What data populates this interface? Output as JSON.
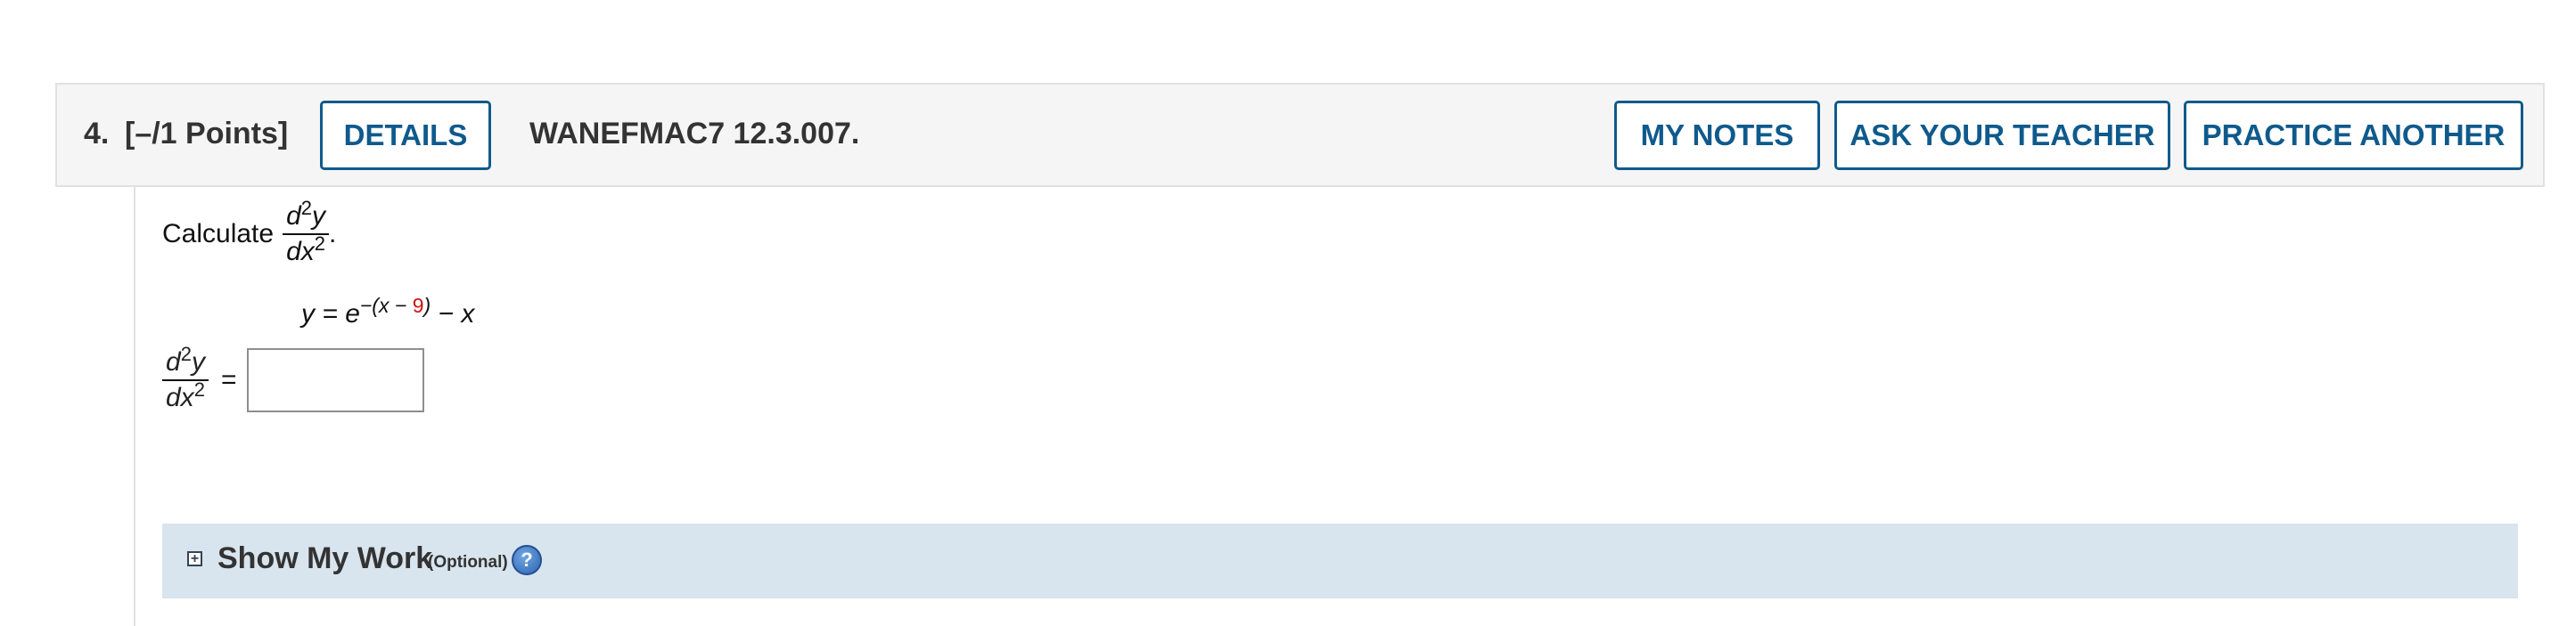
{
  "question": {
    "number": "4.",
    "points": "[–/1 Points]",
    "code": "WANEFMAC7 12.3.007."
  },
  "buttons": {
    "details": "DETAILS",
    "my_notes": "MY NOTES",
    "ask_teacher": "ASK YOUR TEACHER",
    "practice_another": "PRACTICE ANOTHER"
  },
  "prompt": {
    "calculate_label": "Calculate",
    "derivative_numerator": "d",
    "derivative_numerator_exp": "2",
    "derivative_numerator_var": "y",
    "derivative_denominator": "dx",
    "derivative_denominator_exp": "2",
    "trailing_period": "."
  },
  "equation": {
    "lhs": "y = e",
    "exponent_prefix": "−(x − ",
    "exponent_constant": "9",
    "exponent_suffix": ")",
    "rhs": " − x"
  },
  "answer": {
    "equals": "=",
    "value": ""
  },
  "show_my_work": {
    "expand_icon": "plus-box-icon",
    "title": "Show My Work",
    "optional": "(Optional)",
    "help_icon": "?"
  },
  "colors": {
    "button_border": "#0f5a8c",
    "highlight_constant": "#d01010",
    "show_work_bg": "#d8e4ee"
  }
}
